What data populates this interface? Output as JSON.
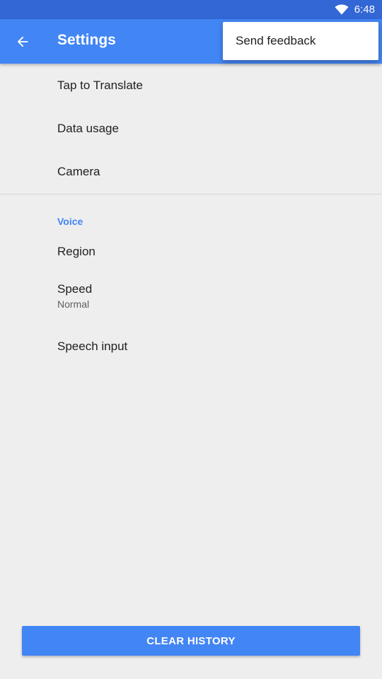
{
  "status_bar": {
    "wifi_icon": "wifi-icon",
    "time": "6:48"
  },
  "app_bar": {
    "back_icon": "arrow-back-icon",
    "title": "Settings"
  },
  "overflow_menu": {
    "items": [
      {
        "label": "Send feedback"
      }
    ]
  },
  "settings": {
    "general_items": [
      {
        "label": "Tap to Translate"
      },
      {
        "label": "Data usage"
      },
      {
        "label": "Camera"
      }
    ],
    "voice_section": {
      "header": "Voice",
      "items": [
        {
          "label": "Region"
        },
        {
          "label": "Speed",
          "summary": "Normal"
        },
        {
          "label": "Speech input"
        }
      ]
    }
  },
  "actions": {
    "clear_history_label": "CLEAR HISTORY"
  },
  "colors": {
    "status_bar": "#3367d6",
    "primary": "#4285f4",
    "background": "#eeeeee",
    "text_primary": "#212121",
    "text_secondary": "#616161"
  }
}
